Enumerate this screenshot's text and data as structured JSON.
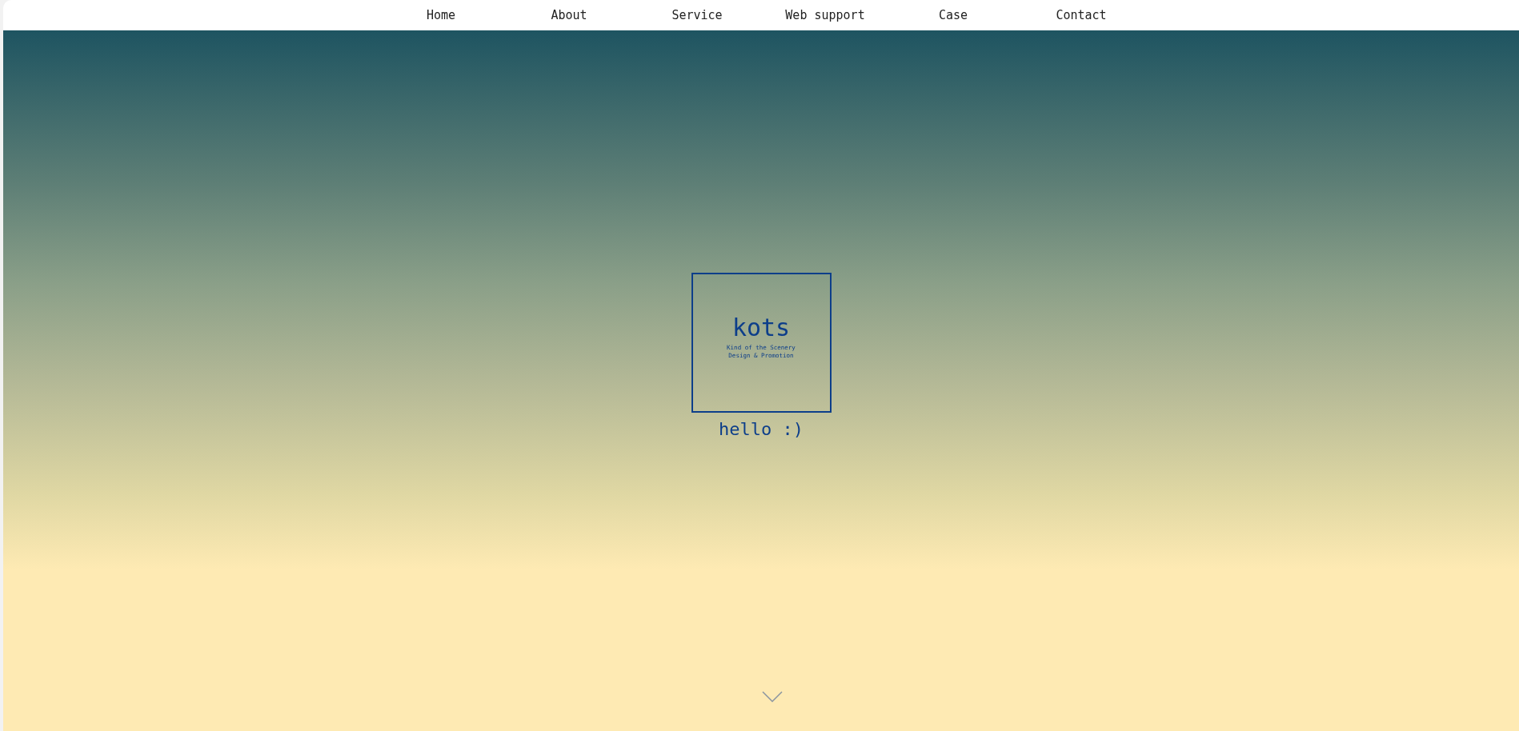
{
  "nav": {
    "items": [
      {
        "label": "Home"
      },
      {
        "label": "About"
      },
      {
        "label": "Service"
      },
      {
        "label": "Web support"
      },
      {
        "label": "Case"
      },
      {
        "label": "Contact"
      }
    ]
  },
  "hero": {
    "logo": {
      "title": "kots",
      "tagline": [
        "Kind of the Scenery",
        "Design & Promotion"
      ]
    },
    "greeting": "hello :)"
  }
}
